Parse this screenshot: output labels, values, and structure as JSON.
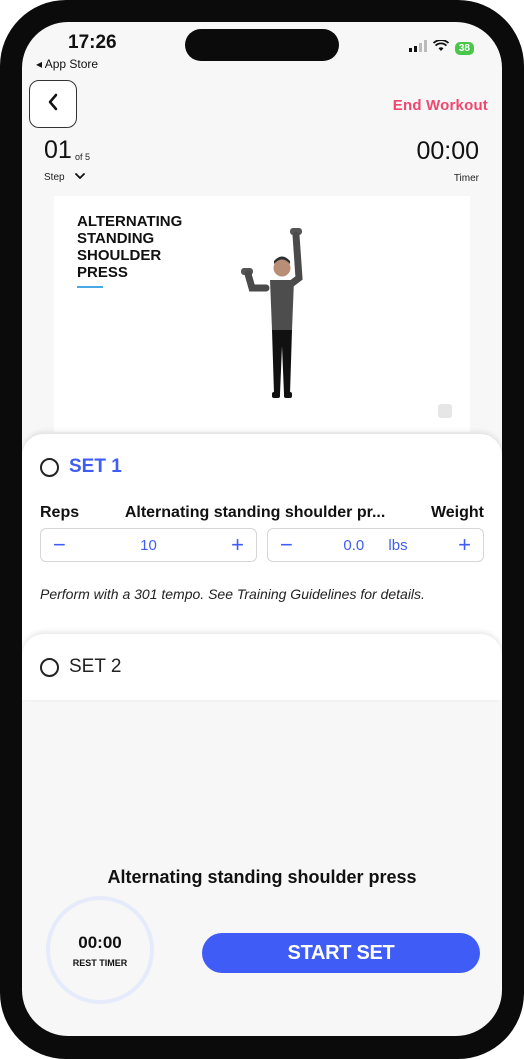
{
  "status": {
    "time": "17:26",
    "back_app": "App Store",
    "battery": "38"
  },
  "header": {
    "end_workout": "End Workout"
  },
  "step": {
    "current": "01",
    "of": "of 5",
    "label": "Step"
  },
  "timer": {
    "value": "00:00",
    "label": "Timer"
  },
  "exercise_card": {
    "title": "Alternating standing shoulder press"
  },
  "set1": {
    "label": "SET 1",
    "reps_header": "Reps",
    "exercise_header": "Alternating standing shoulder pr...",
    "weight_header": "Weight",
    "reps_value": "10",
    "weight_value": "0.0",
    "weight_unit": "lbs",
    "minus": "−",
    "plus": "+",
    "note": "Perform with a 301 tempo. See Training Guidelines for details."
  },
  "set2": {
    "label": "SET 2"
  },
  "footer": {
    "exercise_name": "Alternating standing shoulder press",
    "rest_time": "00:00",
    "rest_label": "REST TIMER",
    "start_button": "START SET"
  },
  "colors": {
    "accent": "#3f5cf6",
    "end_workout": "#f0476f",
    "battery": "#48c74a"
  },
  "icons": [
    "back-chevron-icon",
    "chevron-down-icon",
    "signal-icon",
    "wifi-icon",
    "battery-icon",
    "radio-empty-icon"
  ]
}
